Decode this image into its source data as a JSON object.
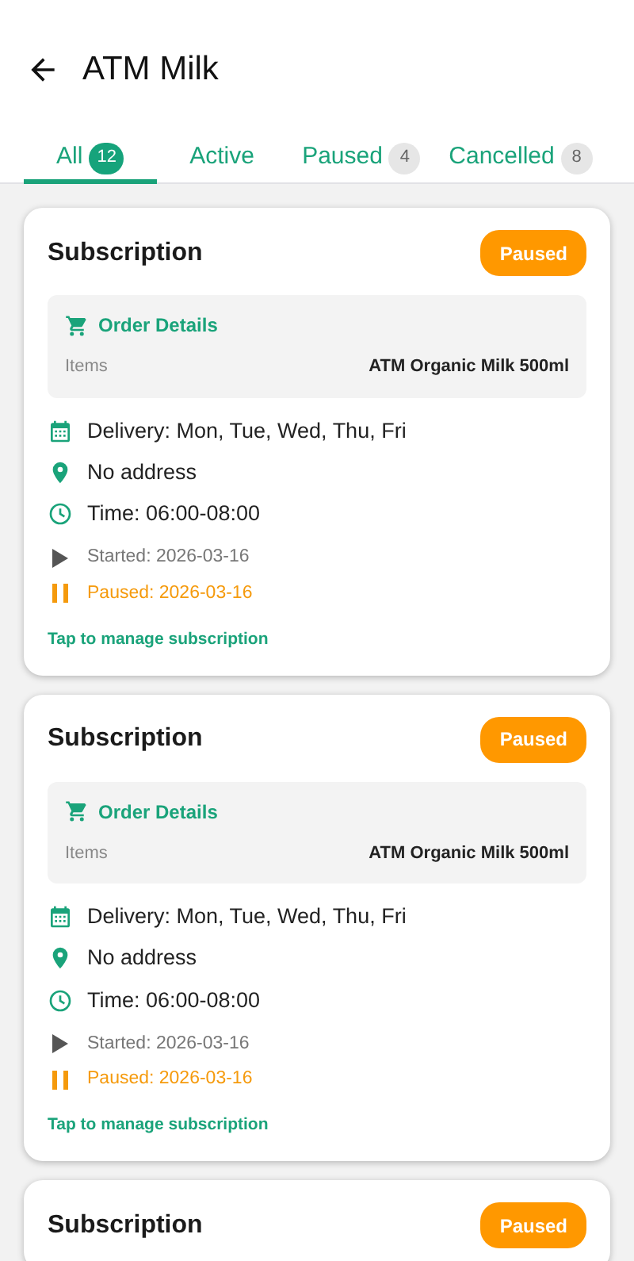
{
  "header": {
    "title": "ATM Milk"
  },
  "tabs": [
    {
      "label": "All",
      "count": "12",
      "selected": true
    },
    {
      "label": "Active",
      "selected": false
    },
    {
      "label": "Paused",
      "count": "4",
      "selected": false
    },
    {
      "label": "Cancelled",
      "count": "8",
      "selected": false
    }
  ],
  "cards": [
    {
      "title": "Subscription",
      "status": "Paused",
      "order": {
        "heading": "Order Details",
        "label": "Items",
        "value": "ATM Organic Milk 500ml"
      },
      "info": [
        {
          "kind": "calendar",
          "text": "Delivery: Mon, Tue, Wed, Thu, Fri"
        },
        {
          "kind": "location",
          "text": "No address"
        },
        {
          "kind": "clock",
          "text": "Time: 06:00-08:00"
        }
      ],
      "dates": [
        {
          "kind": "started",
          "text": "Started: 2026-03-16"
        },
        {
          "kind": "paused",
          "text": "Paused: 2026-03-16"
        }
      ],
      "hint": "Tap to manage subscription"
    },
    {
      "title": "Subscription",
      "status": "Paused",
      "order": {
        "heading": "Order Details",
        "label": "Items",
        "value": "ATM Organic Milk 500ml"
      },
      "info": [
        {
          "kind": "calendar",
          "text": "Delivery: Mon, Tue, Wed, Thu, Fri"
        },
        {
          "kind": "location",
          "text": "No address"
        },
        {
          "kind": "clock",
          "text": "Time: 06:00-08:00"
        }
      ],
      "dates": [
        {
          "kind": "started",
          "text": "Started: 2026-03-16"
        },
        {
          "kind": "paused",
          "text": "Paused: 2026-03-16"
        }
      ],
      "hint": "Tap to manage subscription"
    },
    {
      "title": "Subscription",
      "status": "Paused"
    }
  ]
}
